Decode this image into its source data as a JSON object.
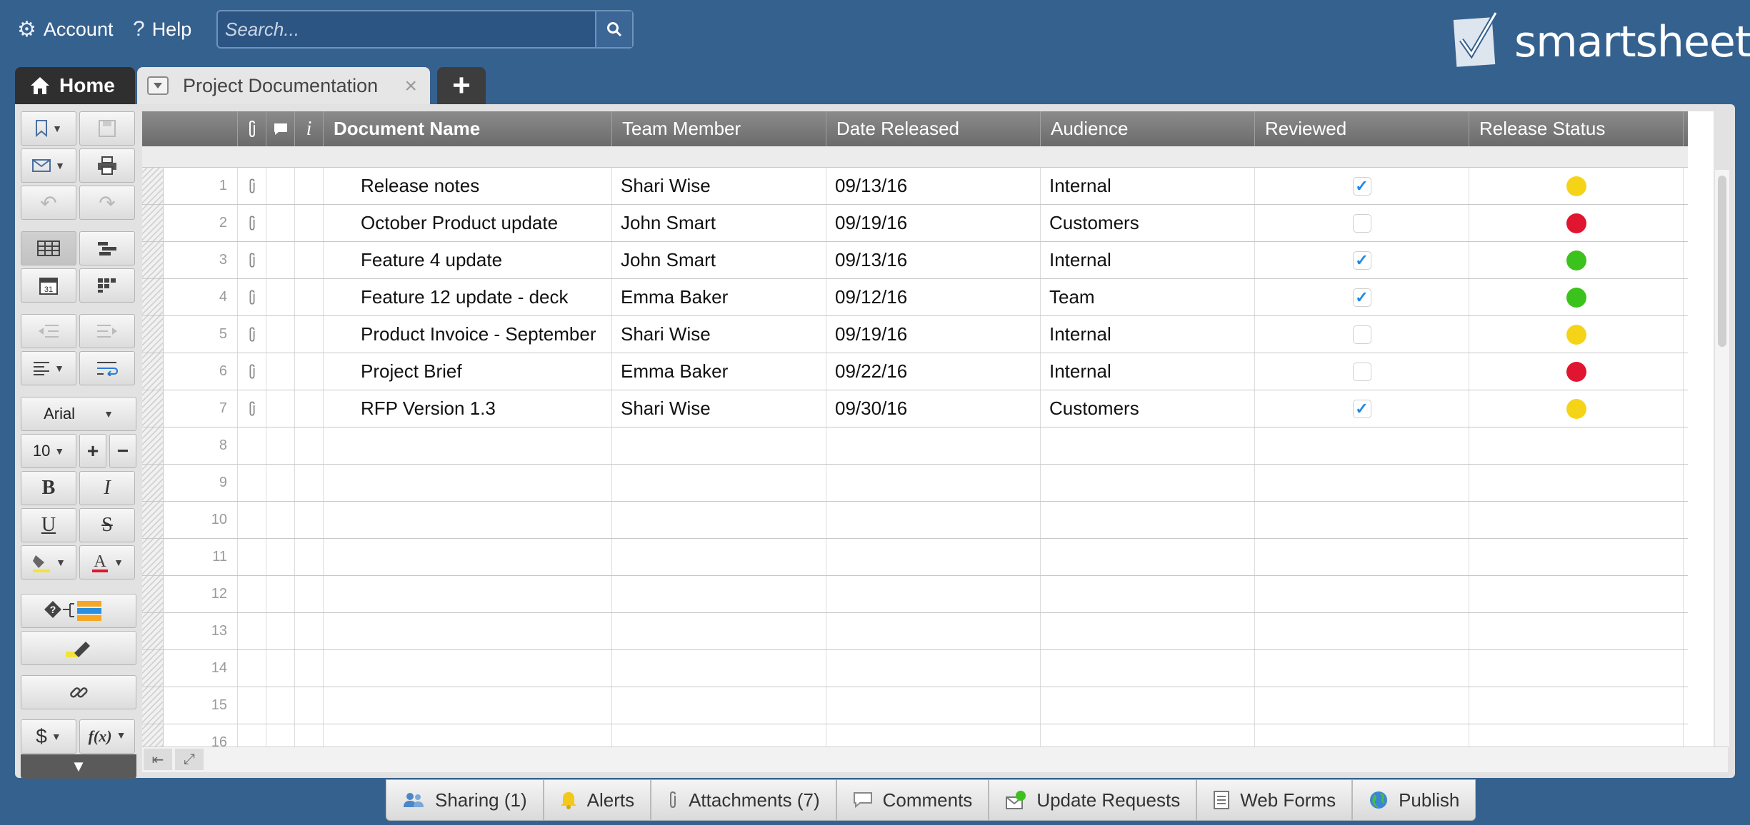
{
  "header": {
    "account_label": "Account",
    "help_label": "Help",
    "search_placeholder": "Search...",
    "logo_text": "smartsheet"
  },
  "tabs": {
    "home_label": "Home",
    "sheet_label": "Project Documentation",
    "add_label": "+"
  },
  "toolbar": {
    "font_name": "Arial",
    "font_size": "10",
    "bold": "B",
    "italic": "I",
    "underline": "U",
    "strike": "S",
    "currency": "$",
    "formula": "f(x)"
  },
  "columns": [
    "Document Name",
    "Team Member",
    "Date Released",
    "Audience",
    "Reviewed",
    "Release Status"
  ],
  "rows": [
    {
      "num": "1",
      "doc": "Release notes",
      "team": "Shari Wise",
      "date": "09/13/16",
      "audience": "Internal",
      "reviewed": true,
      "status": "#f5d418"
    },
    {
      "num": "2",
      "doc": "October Product update",
      "team": "John Smart",
      "date": "09/19/16",
      "audience": "Customers",
      "reviewed": false,
      "status": "#e0152f"
    },
    {
      "num": "3",
      "doc": "Feature 4 update",
      "team": "John Smart",
      "date": "09/13/16",
      "audience": "Internal",
      "reviewed": true,
      "status": "#3cc21c"
    },
    {
      "num": "4",
      "doc": "Feature 12 update - deck",
      "team": "Emma Baker",
      "date": "09/12/16",
      "audience": "Team",
      "reviewed": true,
      "status": "#3cc21c"
    },
    {
      "num": "5",
      "doc": "Product Invoice - September",
      "team": "Shari Wise",
      "date": "09/19/16",
      "audience": "Internal",
      "reviewed": false,
      "status": "#f5d418"
    },
    {
      "num": "6",
      "doc": "Project Brief",
      "team": "Emma Baker",
      "date": "09/22/16",
      "audience": "Internal",
      "reviewed": false,
      "status": "#e0152f"
    },
    {
      "num": "7",
      "doc": "RFP Version 1.3",
      "team": "Shari Wise",
      "date": "09/30/16",
      "audience": "Customers",
      "reviewed": true,
      "status": "#f5d418"
    }
  ],
  "empty_rows": [
    "8",
    "9",
    "10",
    "11",
    "12",
    "13",
    "14",
    "15",
    "16"
  ],
  "bottom": {
    "sharing": "Sharing (1)",
    "alerts": "Alerts",
    "attachments": "Attachments (7)",
    "comments": "Comments",
    "update_requests": "Update Requests",
    "web_forms": "Web Forms",
    "publish": "Publish"
  },
  "colors": {
    "background": "#35618f",
    "header_gray": "#7a7a7a",
    "check_blue": "#1e88e5",
    "status_yellow": "#f5d418",
    "status_red": "#e0152f",
    "status_green": "#3cc21c"
  }
}
